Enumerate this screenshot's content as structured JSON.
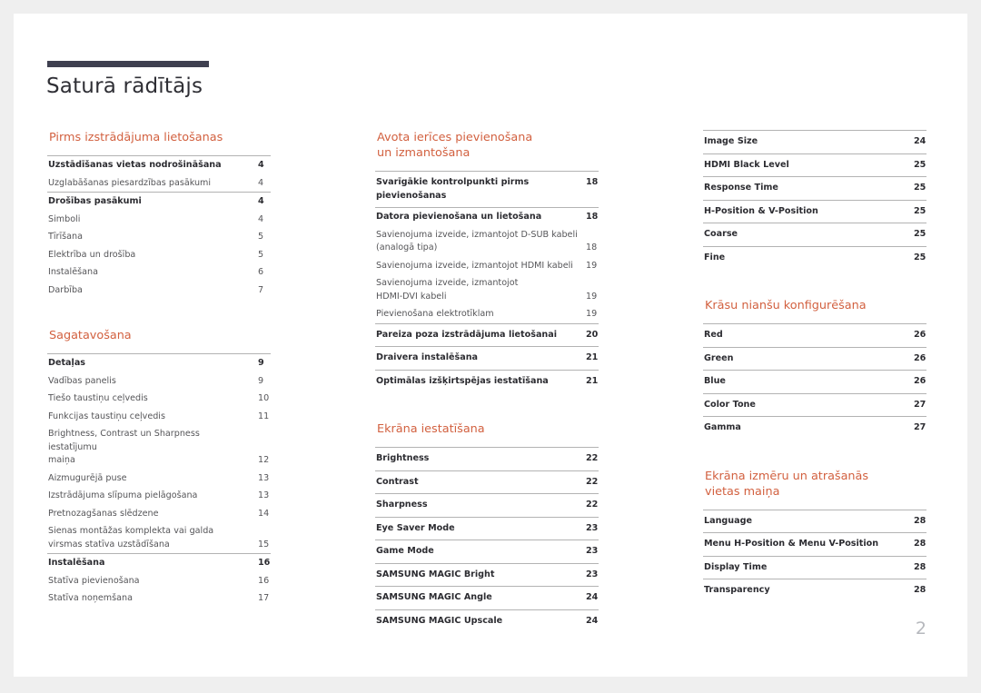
{
  "document": {
    "title": "Saturā rādītājs",
    "page_number": "2",
    "accent_color": "#d2603f",
    "rule_color": "#3f4050"
  },
  "columns": [
    {
      "name": "column-1",
      "sections": [
        {
          "title": "Pirms izstrādājuma lietošanas",
          "groups": [
            {
              "entries": [
                {
                  "label": "Uzstādīšanas vietas nodrošināšana",
                  "page": "4",
                  "lead": true
                },
                {
                  "label": "Uzglabāšanas piesardzības pasākumi",
                  "page": "4",
                  "lead": false
                }
              ]
            },
            {
              "entries": [
                {
                  "label": "Drošības pasākumi",
                  "page": "4",
                  "lead": true
                },
                {
                  "label": "Simboli",
                  "page": "4",
                  "lead": false
                },
                {
                  "label": "Tīrīšana",
                  "page": "5",
                  "lead": false
                },
                {
                  "label": "Elektrība un drošība",
                  "page": "5",
                  "lead": false
                },
                {
                  "label": "Instalēšana",
                  "page": "6",
                  "lead": false
                },
                {
                  "label": "Darbība",
                  "page": "7",
                  "lead": false
                }
              ]
            }
          ]
        },
        {
          "title": "Sagatavošana",
          "groups": [
            {
              "entries": [
                {
                  "label": "Detaļas",
                  "page": "9",
                  "lead": true
                },
                {
                  "label": "Vadības panelis",
                  "page": "9",
                  "lead": false
                },
                {
                  "label": "Tiešo taustiņu ceļvedis",
                  "page": "10",
                  "lead": false
                },
                {
                  "label": "Funkcijas taustiņu ceļvedis",
                  "page": "11",
                  "lead": false
                },
                {
                  "label": "Brightness, Contrast un Sharpness iestatījumu\nmaiņa",
                  "page": "12",
                  "lead": false,
                  "wrap": true
                },
                {
                  "label": "Aizmugurējā puse",
                  "page": "13",
                  "lead": false
                },
                {
                  "label": "Izstrādājuma slīpuma pielāgošana",
                  "page": "13",
                  "lead": false
                },
                {
                  "label": "Pretnozagšanas slēdzene",
                  "page": "14",
                  "lead": false
                },
                {
                  "label": "Sienas montāžas komplekta vai galda\nvirsmas statīva uzstādīšana",
                  "page": "15",
                  "lead": false,
                  "wrap": true
                }
              ]
            },
            {
              "entries": [
                {
                  "label": "Instalēšana",
                  "page": "16",
                  "lead": true
                },
                {
                  "label": "Statīva pievienošana",
                  "page": "16",
                  "lead": false
                },
                {
                  "label": "Statīva noņemšana",
                  "page": "17",
                  "lead": false
                }
              ]
            }
          ]
        }
      ]
    },
    {
      "name": "column-2",
      "sections": [
        {
          "title": "Avota ierīces pievienošana\nun izmantošana",
          "groups": [
            {
              "entries": [
                {
                  "label": "Svarīgākie kontrolpunkti pirms pievienošanas",
                  "page": "18",
                  "lead": true
                }
              ]
            },
            {
              "entries": [
                {
                  "label": "Datora pievienošana un lietošana",
                  "page": "18",
                  "lead": true
                },
                {
                  "label": "Savienojuma izveide, izmantojot D-SUB kabeli\n(analogā tipa)",
                  "page": "18",
                  "lead": false,
                  "wrap": true
                },
                {
                  "label": "Savienojuma izveide, izmantojot HDMI kabeli",
                  "page": "19",
                  "lead": false
                },
                {
                  "label": "Savienojuma izveide, izmantojot\nHDMI-DVI kabeli",
                  "page": "19",
                  "lead": false,
                  "wrap": true
                },
                {
                  "label": "Pievienošana elektrotīklam",
                  "page": "19",
                  "lead": false
                }
              ]
            },
            {
              "entries": [
                {
                  "label": "Pareiza poza izstrādājuma lietošanai",
                  "page": "20",
                  "lead": true
                }
              ]
            },
            {
              "entries": [
                {
                  "label": "Draivera instalēšana",
                  "page": "21",
                  "lead": true
                }
              ]
            },
            {
              "entries": [
                {
                  "label": "Optimālas izšķirtspējas iestatīšana",
                  "page": "21",
                  "lead": true
                }
              ]
            }
          ]
        },
        {
          "title": "Ekrāna iestatīšana",
          "groups": [
            {
              "entries": [
                {
                  "label": "Brightness",
                  "page": "22",
                  "lead": true
                }
              ]
            },
            {
              "entries": [
                {
                  "label": "Contrast",
                  "page": "22",
                  "lead": true
                }
              ]
            },
            {
              "entries": [
                {
                  "label": "Sharpness",
                  "page": "22",
                  "lead": true
                }
              ]
            },
            {
              "entries": [
                {
                  "label": "Eye Saver Mode",
                  "page": "23",
                  "lead": true
                }
              ]
            },
            {
              "entries": [
                {
                  "label": "Game Mode",
                  "page": "23",
                  "lead": true
                }
              ]
            },
            {
              "entries": [
                {
                  "label": "SAMSUNG MAGIC Bright",
                  "page": "23",
                  "lead": true
                }
              ]
            },
            {
              "entries": [
                {
                  "label": "SAMSUNG MAGIC Angle",
                  "page": "24",
                  "lead": true
                }
              ]
            },
            {
              "entries": [
                {
                  "label": "SAMSUNG MAGIC Upscale",
                  "page": "24",
                  "lead": true
                }
              ]
            }
          ]
        }
      ]
    },
    {
      "name": "column-3",
      "sections": [
        {
          "title": "",
          "groups": [
            {
              "entries": [
                {
                  "label": "Image Size",
                  "page": "24",
                  "lead": true
                }
              ]
            },
            {
              "entries": [
                {
                  "label": "HDMI Black Level",
                  "page": "25",
                  "lead": true
                }
              ]
            },
            {
              "entries": [
                {
                  "label": "Response Time",
                  "page": "25",
                  "lead": true
                }
              ]
            },
            {
              "entries": [
                {
                  "label": "H-Position & V-Position",
                  "page": "25",
                  "lead": true
                }
              ]
            },
            {
              "entries": [
                {
                  "label": "Coarse",
                  "page": "25",
                  "lead": true
                }
              ]
            },
            {
              "entries": [
                {
                  "label": "Fine",
                  "page": "25",
                  "lead": true
                }
              ]
            }
          ]
        },
        {
          "title": "Krāsu nianšu konfigurēšana",
          "groups": [
            {
              "entries": [
                {
                  "label": "Red",
                  "page": "26",
                  "lead": true
                }
              ]
            },
            {
              "entries": [
                {
                  "label": "Green",
                  "page": "26",
                  "lead": true
                }
              ]
            },
            {
              "entries": [
                {
                  "label": "Blue",
                  "page": "26",
                  "lead": true
                }
              ]
            },
            {
              "entries": [
                {
                  "label": "Color Tone",
                  "page": "27",
                  "lead": true
                }
              ]
            },
            {
              "entries": [
                {
                  "label": "Gamma",
                  "page": "27",
                  "lead": true
                }
              ]
            }
          ]
        },
        {
          "title": "Ekrāna izmēru un atrašanās\nvietas maiņa",
          "groups": [
            {
              "entries": [
                {
                  "label": "Language",
                  "page": "28",
                  "lead": true
                }
              ]
            },
            {
              "entries": [
                {
                  "label": "Menu H-Position & Menu V-Position",
                  "page": "28",
                  "lead": true
                }
              ]
            },
            {
              "entries": [
                {
                  "label": "Display Time",
                  "page": "28",
                  "lead": true
                }
              ]
            },
            {
              "entries": [
                {
                  "label": "Transparency",
                  "page": "28",
                  "lead": true
                }
              ]
            }
          ]
        }
      ]
    }
  ]
}
